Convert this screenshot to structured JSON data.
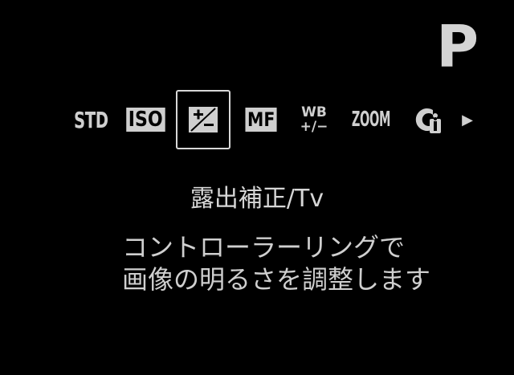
{
  "mode": "P",
  "function_bar": {
    "items": [
      {
        "label": "STD",
        "icon": "picture-style-std"
      },
      {
        "label": "ISO",
        "icon": "iso-icon"
      },
      {
        "label": "+/-",
        "icon": "exposure-compensation-icon",
        "selected": true
      },
      {
        "label": "MF",
        "icon": "manual-focus-icon"
      },
      {
        "label_top": "WB",
        "label_bottom": "+/−",
        "icon": "white-balance-shift-icon"
      },
      {
        "label": "ZOOM",
        "icon": "zoom-icon"
      },
      {
        "label": "Ci",
        "icon": "custom-control-icon"
      }
    ],
    "more_arrow": "▶"
  },
  "selected_title": "露出補正/Tv",
  "description_line1": "コントローラーリングで",
  "description_line2": "画像の明るさを調整します"
}
